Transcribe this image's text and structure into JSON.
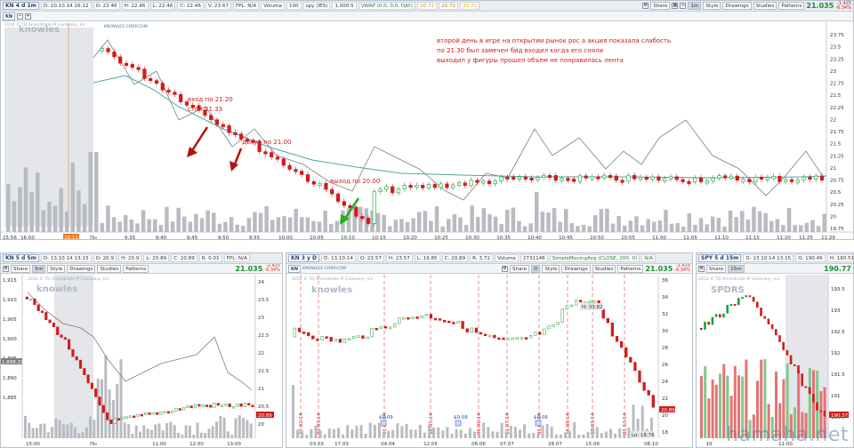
{
  "colors": {
    "up": "#1b9e3a",
    "down": "#d21a1a",
    "sma": "#4aa89f",
    "compare": "#7d7d7d",
    "volume": "#b8bcc2",
    "annotation": "#d21a1a"
  },
  "main": {
    "symbol": "KN 4 d 1m",
    "date": "D: 10.10.14 16:12",
    "open": "O: 22.46",
    "high": "H: 22.46",
    "low": "L: 22.46",
    "close": "C: 22.46",
    "volume": "V: 23.67",
    "fpl": "FPL: N/A",
    "volume_label": "Volume",
    "volume_value": "100",
    "spy_label": "spy (IES)",
    "spy_value": "1,000.5",
    "vwap_label": "VWAP (0,0, 0,0, DAY)",
    "vwap_values": [
      "20.72",
      "20.72",
      "20.72"
    ],
    "buttons": {
      "share": "Share",
      "interval": "1m",
      "style": "Style",
      "drawings": "Drawings",
      "studies": "Studies",
      "patterns": "Patterns"
    },
    "last_price": "21.035",
    "change": [
      "-1.425",
      "-6.34%"
    ],
    "watermark_company": "knowles",
    "watermark_corp": "KNOWLES CORP.COM",
    "copyright": "2014 © TD Ameritrade IP Company, Inc.",
    "hdr2_symbol": "KN",
    "annotations": [
      "второй день в игре на открытии рынок рос а акция показала слабость",
      "по 21.30 был замечен бид входил когда его сняли",
      "выходил у фигуры прошел объем не понравилась лента"
    ],
    "entry_note": [
      "вход по 21.20",
      "стоп 21.33"
    ],
    "add_note": "докуп по 21.00",
    "exit_note": "выход по 20.00",
    "y_ticks": [
      "23.75",
      "23.5",
      "23.25",
      "23",
      "22.75",
      "22.5",
      "22.25",
      "22",
      "21.75",
      "21.5",
      "21.25",
      "21",
      "20.75",
      "20.5",
      "20.25",
      "20",
      "19.75"
    ],
    "x_ticks": [
      "15:56",
      "16:00",
      "Пн",
      "9:35",
      "9:40",
      "9:45",
      "9:50",
      "9:55",
      "10:00",
      "10:05",
      "10:10",
      "10:15",
      "10:20",
      "10:25",
      "10:30",
      "10:35",
      "10:40",
      "10:45",
      "10:50",
      "10:55",
      "11:00",
      "11:05",
      "11:10",
      "11:15",
      "11:20",
      "11:25",
      "11:29"
    ],
    "x_marker": "16:12"
  },
  "bl": {
    "symbol": "KN 5 d 5m",
    "date": "D: 13.10.14 13:15",
    "open": "O: 20.9",
    "high": "H: 20.9",
    "low": "L: 20.89",
    "close": "C: 20.89",
    "r": "R: 0.01",
    "fpl": "FPL: N/A",
    "last_price": "21.035",
    "change": [
      "-1.425",
      "-6.34%"
    ],
    "buttons": {
      "share": "Share",
      "interval": "5m",
      "style": "Style",
      "drawings": "Drawings",
      "studies": "Studies",
      "patterns": "Patterns"
    },
    "left_ticks": [
      "1,915",
      "1,910",
      "1,905",
      "1,900",
      "1,895",
      "1,890",
      "1,885"
    ],
    "left_tag": "1,898.29",
    "right_ticks": [
      "24",
      "23.5",
      "23",
      "22.5",
      "22",
      "21.5",
      "21",
      "20.5",
      "20"
    ],
    "right_tag": "20.89",
    "x_ticks": [
      "15:00",
      "Пн",
      "11:00",
      "12:00",
      "13:00"
    ],
    "watermark_company": "knowles",
    "copyright": "2014 © TD Ameritrade IP Company, Inc."
  },
  "bm": {
    "symbol": "KN 3 y D",
    "date": "D: 13.10.14",
    "open": "O: 23.57",
    "high": "H: 23.57",
    "low": "L: 19.85",
    "close": "C: 20.89",
    "r": "R: 3.72",
    "volume_label": "Volume",
    "volume_value": "2731146",
    "sma_label": "SimpleMovingAvg (CLOSE, 200, 0)",
    "sma_value": "N/A",
    "buttons": {
      "share": "Share",
      "interval": "D",
      "style": "Style",
      "drawings": "Drawings",
      "studies": "Studies",
      "patterns": "Patterns"
    },
    "last_price": "21.035",
    "change": [
      "-1.425",
      "-6.34%"
    ],
    "hdr2_symbol": "KN",
    "watermark_corp": "KNOWLES CORP.COM",
    "watermark_company": "knowles",
    "copyright": "2014 © TD Ameritrade IP Company, Inc.",
    "y_ticks": [
      "36",
      "34",
      "32",
      "30",
      "28",
      "26",
      "24",
      "22",
      "20",
      "18"
    ],
    "high_tag": "H: 33.82",
    "low_tag": "Lo: 18.76",
    "last_tag": "20.89",
    "x_ticks": [
      "03.03",
      "17.03",
      "04.04",
      "12.05",
      "06.06",
      "07.07",
      "28.07",
      "15.09",
      "06.10"
    ],
    "dividends": [
      "$0.09",
      "$0.09",
      "$0.09"
    ],
    "event_dates": [
      "17.02.14",
      "03.03.14",
      "01.04.14",
      "12.05.14",
      "06.06.14",
      "01.07.14",
      "01.08.14",
      "14.08.14",
      "15.09.14",
      "01.10.14"
    ]
  },
  "br": {
    "symbol": "SPY 5 d 15m",
    "date": "D: 13.10.14 13:15",
    "open": "O: 190.49",
    "high": "H: 190.51",
    "last_price": "190.77",
    "buttons": {
      "share": "Share",
      "interval": "15m"
    },
    "watermark_company": "SPDRS",
    "copyright": "2014 © TD Ameritrade IP Company, Inc.",
    "y_ticks": [
      "193.5",
      "193",
      "192.5",
      "192",
      "191.5",
      "191",
      "190.5"
    ],
    "last_tag": "190.37",
    "x_ticks": [
      "10",
      "11:00"
    ]
  },
  "site_watermark": "hamaha.net"
}
